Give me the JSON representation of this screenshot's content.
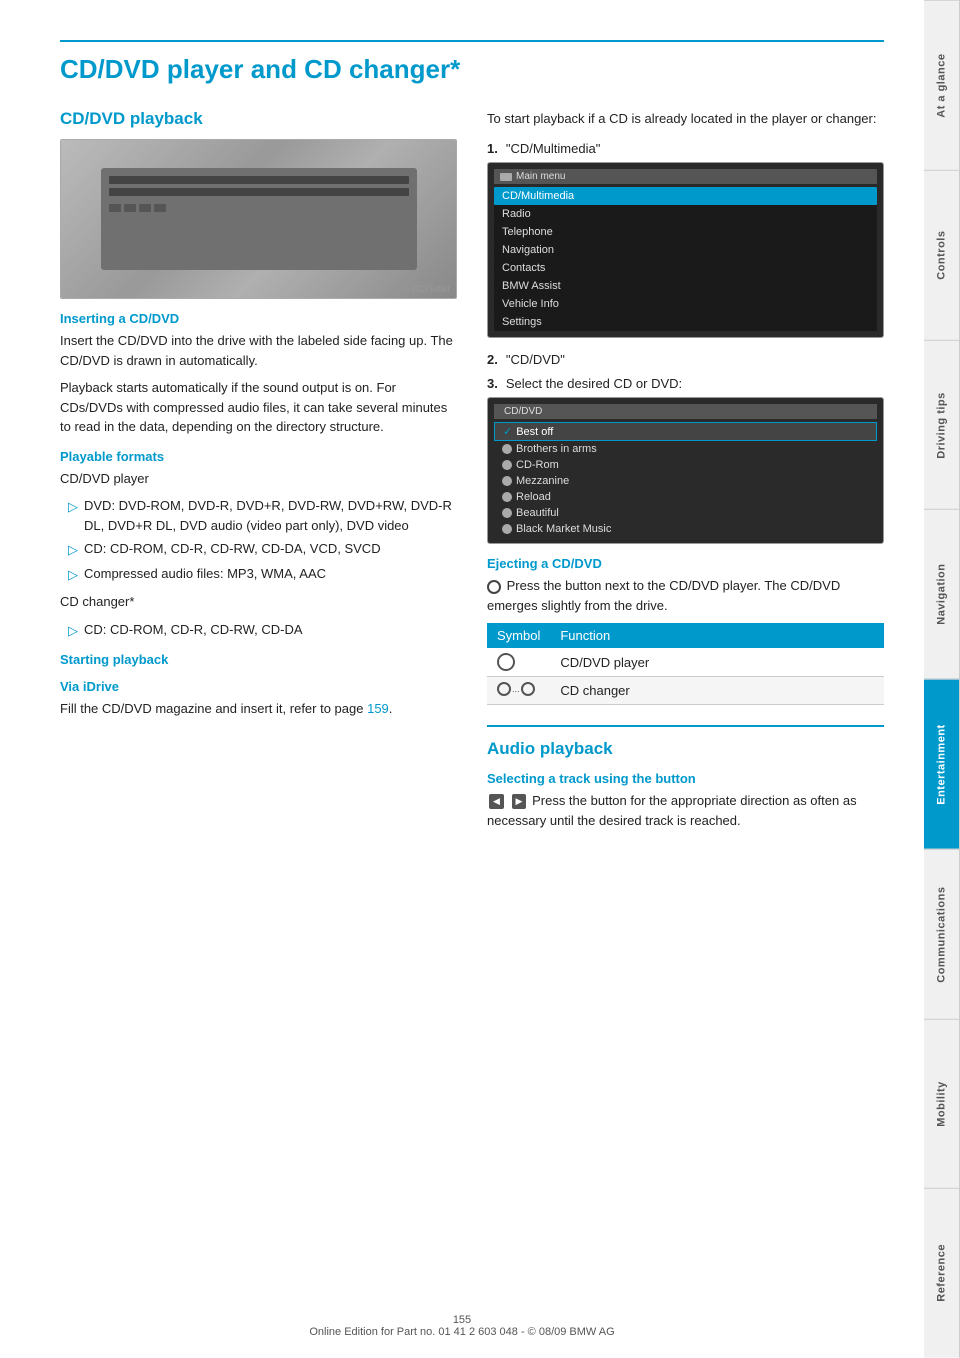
{
  "page": {
    "title": "CD/DVD player and CD changer*",
    "page_number": "155",
    "footer_text": "Online Edition for Part no. 01 41 2 603 048 - © 08/09 BMW AG"
  },
  "sidebar": {
    "tabs": [
      {
        "label": "At a glance",
        "active": false
      },
      {
        "label": "Controls",
        "active": false
      },
      {
        "label": "Driving tips",
        "active": false
      },
      {
        "label": "Navigation",
        "active": false
      },
      {
        "label": "Entertainment",
        "active": true
      },
      {
        "label": "Communications",
        "active": false
      },
      {
        "label": "Mobility",
        "active": false
      },
      {
        "label": "Reference",
        "active": false
      }
    ]
  },
  "left_column": {
    "cd_dvd_playback": {
      "heading": "CD/DVD playback",
      "inserting_heading": "Inserting a CD/DVD",
      "inserting_text1": "Insert the CD/DVD into the drive with the labeled side facing up. The CD/DVD is drawn in automatically.",
      "inserting_text2": "Playback starts automatically if the sound output is on. For CDs/DVDs with compressed audio files, it can take several minutes to read in the data, depending on the directory structure.",
      "playable_heading": "Playable formats",
      "player_label": "CD/DVD player",
      "dvd_bullet": "DVD: DVD-ROM, DVD-R, DVD+R, DVD-RW, DVD+RW, DVD-R DL, DVD+R DL, DVD audio (video part only), DVD video",
      "cd_bullet": "CD: CD-ROM, CD-R, CD-RW, CD-DA, VCD, SVCD",
      "compressed_bullet": "Compressed audio files: MP3, WMA, AAC",
      "changer_label": "CD changer*",
      "changer_cd_bullet": "CD: CD-ROM, CD-R, CD-RW, CD-DA"
    },
    "starting_playback": {
      "heading": "Starting playback",
      "via_idrive_heading": "Via iDrive",
      "via_idrive_text": "Fill the CD/DVD magazine and insert it, refer to page 159."
    }
  },
  "right_column": {
    "start_playback_text": "To start playback if a CD is already located in the player or changer:",
    "steps": [
      {
        "num": "1.",
        "text": "\"CD/Multimedia\""
      },
      {
        "num": "2.",
        "text": "\"CD/DVD\""
      },
      {
        "num": "3.",
        "text": "Select the desired CD or DVD:"
      }
    ],
    "main_menu": {
      "title": "Main menu",
      "items": [
        {
          "label": "CD/Multimedia",
          "selected": true
        },
        {
          "label": "Radio",
          "selected": false
        },
        {
          "label": "Telephone",
          "selected": false
        },
        {
          "label": "Navigation",
          "selected": false
        },
        {
          "label": "Contacts",
          "selected": false
        },
        {
          "label": "BMW Assist",
          "selected": false
        },
        {
          "label": "Vehicle Info",
          "selected": false
        },
        {
          "label": "Settings",
          "selected": false
        }
      ]
    },
    "cd_menu": {
      "title": "CD/DVD",
      "items": [
        {
          "label": "Best off",
          "selected": true
        },
        {
          "label": "Brothers in arms",
          "selected": false
        },
        {
          "label": "CD-Rom",
          "selected": false
        },
        {
          "label": "Mezzanine",
          "selected": false
        },
        {
          "label": "Reload",
          "selected": false
        },
        {
          "label": "Beautiful",
          "selected": false
        },
        {
          "label": "Black Market Music",
          "selected": false
        }
      ]
    },
    "ejecting_heading": "Ejecting a CD/DVD",
    "ejecting_text": "Press the button next to the CD/DVD player. The CD/DVD emerges slightly from the drive.",
    "table_headers": [
      "Symbol",
      "Function"
    ],
    "table_rows": [
      {
        "symbol": "disc",
        "function": "CD/DVD player"
      },
      {
        "symbol": "disc-range",
        "function": "CD changer"
      }
    ]
  },
  "audio_section": {
    "heading": "Audio playback",
    "selecting_heading": "Selecting a track using the button",
    "selecting_text": "Press the button for the appropriate direction as often as necessary until the desired track is reached."
  }
}
